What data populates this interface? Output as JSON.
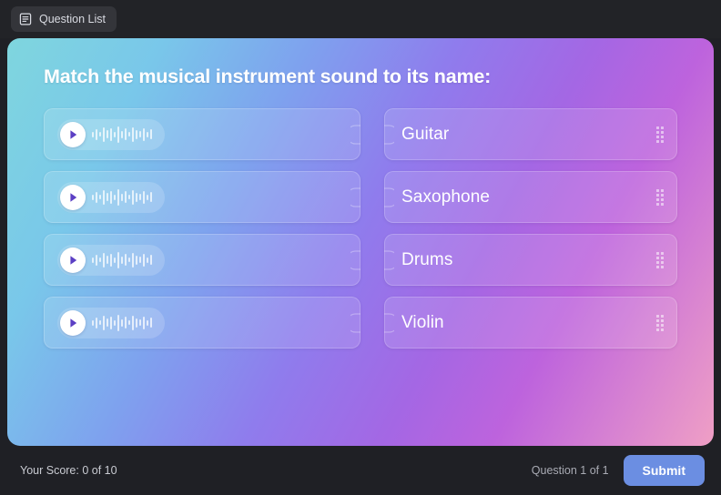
{
  "topbar": {
    "question_list_label": "Question List",
    "question_list_icon": "document-list-icon"
  },
  "quiz": {
    "title": "Match the musical instrument sound to its name:",
    "prompt_icon": "play-icon",
    "drag_handle_icon": "drag-handle-icon",
    "left_items": [
      {
        "type": "audio",
        "play_label": "Play",
        "waveform_name": "audio-waveform"
      },
      {
        "type": "audio",
        "play_label": "Play",
        "waveform_name": "audio-waveform"
      },
      {
        "type": "audio",
        "play_label": "Play",
        "waveform_name": "audio-waveform"
      },
      {
        "type": "audio",
        "play_label": "Play",
        "waveform_name": "audio-waveform"
      }
    ],
    "right_items": [
      {
        "label": "Guitar"
      },
      {
        "label": "Saxophone"
      },
      {
        "label": "Drums"
      },
      {
        "label": "Violin"
      }
    ]
  },
  "footer": {
    "score_text": "Your Score: 0 of 10",
    "question_counter": "Question 1 of 1",
    "submit_label": "Submit"
  },
  "colors": {
    "app_background": "#1f2025",
    "topbar_background": "#222327",
    "chip_background": "#34353a",
    "submit_button": "#6b8ee2",
    "gradient_start": "#7fd6de",
    "gradient_mid": "#9f6be6",
    "gradient_end": "#ef9fc5",
    "text_light": "#ffffff",
    "text_muted": "#a9abb4"
  },
  "waveform_heights": [
    6,
    12,
    5,
    16,
    9,
    14,
    6,
    18,
    8,
    13,
    5,
    16,
    10,
    7,
    14,
    6,
    11
  ]
}
